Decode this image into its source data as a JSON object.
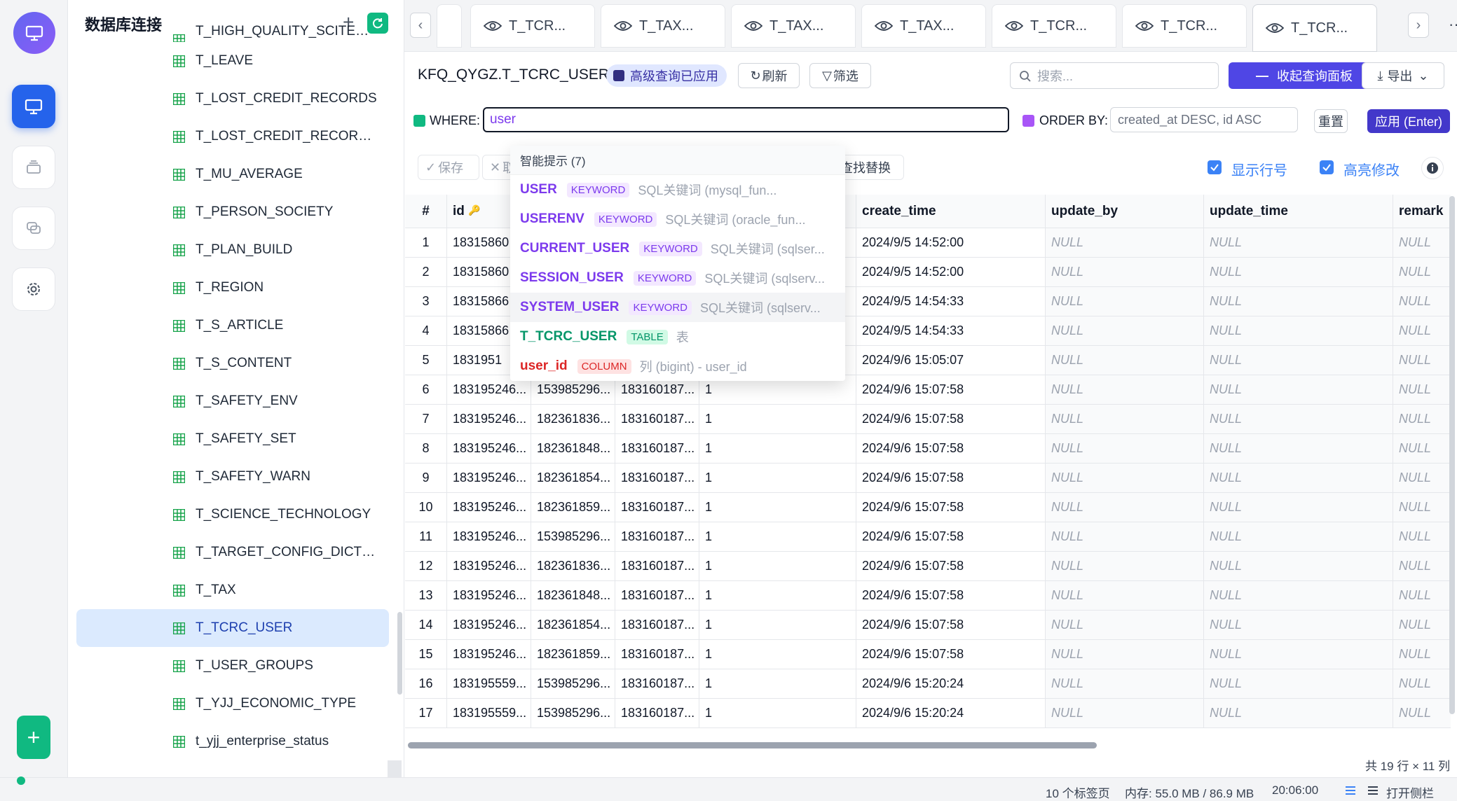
{
  "sidebar": {
    "title": "数据库连接",
    "items": [
      {
        "label": "T_HIGH_QUALITY_SCITECH_E..."
      },
      {
        "label": "T_LEAVE"
      },
      {
        "label": "T_LOST_CREDIT_RECORDS"
      },
      {
        "label": "T_LOST_CREDIT_RECORDS_C..."
      },
      {
        "label": "T_MU_AVERAGE"
      },
      {
        "label": "T_PERSON_SOCIETY"
      },
      {
        "label": "T_PLAN_BUILD"
      },
      {
        "label": "T_REGION"
      },
      {
        "label": "T_S_ARTICLE"
      },
      {
        "label": "T_S_CONTENT"
      },
      {
        "label": "T_SAFETY_ENV"
      },
      {
        "label": "T_SAFETY_SET"
      },
      {
        "label": "T_SAFETY_WARN"
      },
      {
        "label": "T_SCIENCE_TECHNOLOGY"
      },
      {
        "label": "T_TARGET_CONFIG_DICTION..."
      },
      {
        "label": "T_TAX"
      },
      {
        "label": "T_TCRC_USER"
      },
      {
        "label": "T_USER_GROUPS"
      },
      {
        "label": "T_YJJ_ECONOMIC_TYPE"
      },
      {
        "label": "t_yjj_enterprise_status"
      }
    ],
    "selected_index": 16
  },
  "tabs": {
    "items": [
      "T_TCR...",
      "T_TAX...",
      "T_TAX...",
      "T_TAX...",
      "T_TCR...",
      "T_TCR...",
      "T_TCR..."
    ],
    "active_index": 6,
    "more": "···"
  },
  "header": {
    "title": "KFQ_QYGZ.T_TCRC_USER",
    "badge": "高级查询已应用",
    "refresh": "刷新",
    "filter": "筛选",
    "search_placeholder": "搜索...",
    "collapse": "收起查询面板",
    "export": "导出"
  },
  "query": {
    "where_label": "WHERE:",
    "where_value": "user",
    "order_label": "ORDER BY:",
    "order_placeholder": "created_at DESC, id ASC",
    "reset": "重置",
    "apply": "应用 (Enter)"
  },
  "toolbar": {
    "save": "保存",
    "cancel": "取",
    "find_replace": "查找替换",
    "show_row_numbers": "显示行号",
    "highlight_changes": "高亮修改"
  },
  "autocomplete": {
    "header": "智能提示 (7)",
    "items": [
      {
        "name": "USER",
        "type": "KEYWORD",
        "desc": "SQL关键词 (mysql_fun...",
        "kind": "kw"
      },
      {
        "name": "USERENV",
        "type": "KEYWORD",
        "desc": "SQL关键词 (oracle_fun...",
        "kind": "kw"
      },
      {
        "name": "CURRENT_USER",
        "type": "KEYWORD",
        "desc": "SQL关键词 (sqlser...",
        "kind": "kw"
      },
      {
        "name": "SESSION_USER",
        "type": "KEYWORD",
        "desc": "SQL关键词 (sqlserv...",
        "kind": "kw"
      },
      {
        "name": "SYSTEM_USER",
        "type": "KEYWORD",
        "desc": "SQL关键词 (sqlserv...",
        "kind": "kw"
      },
      {
        "name": "T_TCRC_USER",
        "type": "TABLE",
        "desc": "表",
        "kind": "tb"
      },
      {
        "name": "user_id",
        "type": "COLUMN",
        "desc": "列 (bigint) - user_id",
        "kind": "co"
      }
    ],
    "highlighted_index": 4
  },
  "grid": {
    "columns": [
      "#",
      "id",
      "",
      "",
      "",
      "create_time",
      "update_by",
      "update_time",
      "remark"
    ],
    "null_text": "NULL",
    "rows": [
      [
        "1",
        "18315860",
        "",
        "",
        "",
        "2024/9/5 14:52:00"
      ],
      [
        "2",
        "18315860",
        "",
        "",
        "",
        "2024/9/5 14:52:00"
      ],
      [
        "3",
        "18315866",
        "",
        "",
        "",
        "2024/9/5 14:54:33"
      ],
      [
        "4",
        "18315866",
        "",
        "",
        "",
        "2024/9/5 14:54:33"
      ],
      [
        "5",
        "1831951",
        "",
        "",
        "",
        "2024/9/6 15:05:07"
      ],
      [
        "6",
        "183195246...",
        "153985296...",
        "183160187...",
        "1",
        "2024/9/6 15:07:58"
      ],
      [
        "7",
        "183195246...",
        "182361836...",
        "183160187...",
        "1",
        "2024/9/6 15:07:58"
      ],
      [
        "8",
        "183195246...",
        "182361848...",
        "183160187...",
        "1",
        "2024/9/6 15:07:58"
      ],
      [
        "9",
        "183195246...",
        "182361854...",
        "183160187...",
        "1",
        "2024/9/6 15:07:58"
      ],
      [
        "10",
        "183195246...",
        "182361859...",
        "183160187...",
        "1",
        "2024/9/6 15:07:58"
      ],
      [
        "11",
        "183195246...",
        "153985296...",
        "183160187...",
        "1",
        "2024/9/6 15:07:58"
      ],
      [
        "12",
        "183195246...",
        "182361836...",
        "183160187...",
        "1",
        "2024/9/6 15:07:58"
      ],
      [
        "13",
        "183195246...",
        "182361848...",
        "183160187...",
        "1",
        "2024/9/6 15:07:58"
      ],
      [
        "14",
        "183195246...",
        "182361854...",
        "183160187...",
        "1",
        "2024/9/6 15:07:58"
      ],
      [
        "15",
        "183195246...",
        "182361859...",
        "183160187...",
        "1",
        "2024/9/6 15:07:58"
      ],
      [
        "16",
        "183195559...",
        "153985296...",
        "183160187...",
        "1",
        "2024/9/6 15:20:24"
      ],
      [
        "17",
        "183195559...",
        "153985296...",
        "183160187...",
        "1",
        "2024/9/6 15:20:24"
      ]
    ],
    "summary": "共 19 行 × 11 列"
  },
  "status": {
    "tabs_count": "10 个标签页",
    "memory": "内存: 55.0 MB / 86.9 MB",
    "time": "20:06:00",
    "open_sidebar": "打开侧栏"
  },
  "colors": {
    "accent": "#4f46e5",
    "selected": "#dbeafe",
    "success": "#10b981"
  }
}
